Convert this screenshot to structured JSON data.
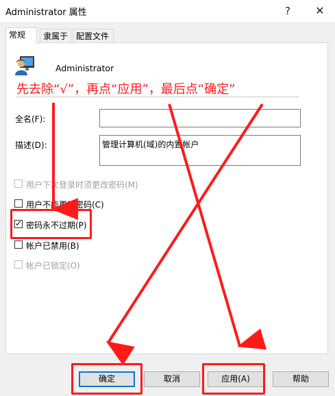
{
  "window": {
    "title": "Administrator 属性",
    "help_glyph": "?",
    "close_glyph": "✕"
  },
  "tabs": [
    {
      "label": "常规"
    },
    {
      "label": "隶属于"
    },
    {
      "label": "配置文件"
    }
  ],
  "user": {
    "name": "Administrator"
  },
  "instruction": "先去除“√”，再点“应用”，最后点“确定”",
  "fields": {
    "fullname_label": "全名(F):",
    "fullname_value": "",
    "description_label": "描述(D):",
    "description_value": "管理计算机(域)的内置帐户"
  },
  "checkboxes": [
    {
      "label": "用户下次登录时须更改密码(M)",
      "checked": false,
      "enabled": false
    },
    {
      "label": "用户不能更改密码(C)",
      "checked": false,
      "enabled": true
    },
    {
      "label": "密码永不过期(P)",
      "checked": true,
      "enabled": true
    },
    {
      "label": "帐户已禁用(B)",
      "checked": false,
      "enabled": true
    },
    {
      "label": "帐户已锁定(O)",
      "checked": false,
      "enabled": false
    }
  ],
  "buttons": {
    "ok": "确定",
    "cancel": "取消",
    "apply": "应用(A)",
    "help": "帮助"
  },
  "colors": {
    "annotation": "#ff1a1a",
    "focus": "#0078d7"
  }
}
